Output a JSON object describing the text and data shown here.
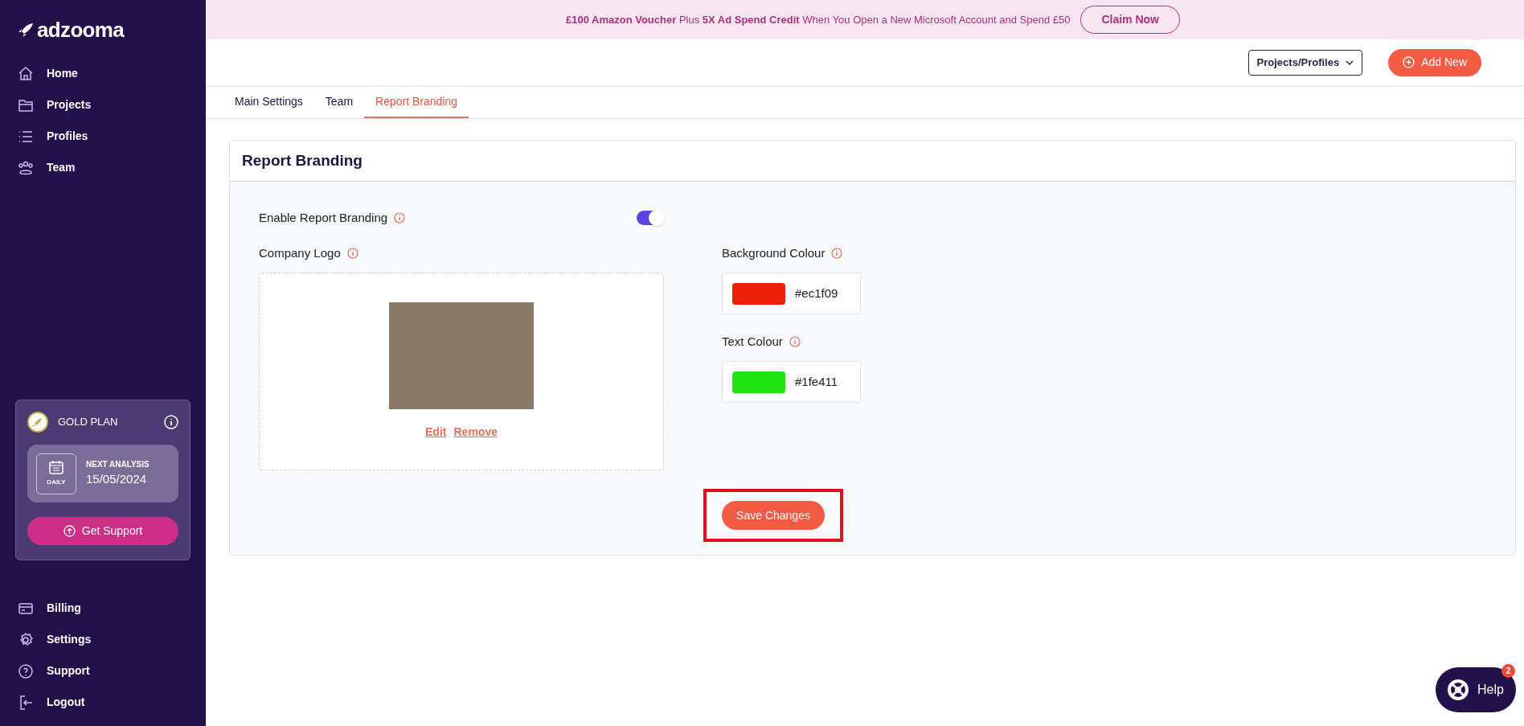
{
  "sidebar": {
    "logo": "adzooma",
    "nav": [
      {
        "label": "Home"
      },
      {
        "label": "Projects"
      },
      {
        "label": "Profiles"
      },
      {
        "label": "Team"
      }
    ],
    "plan": {
      "name": "GOLD PLAN",
      "frequency": "DAILY",
      "next_label": "NEXT ANALYSIS",
      "next_date": "15/05/2024",
      "button": "Get Support"
    },
    "bottom_nav": [
      {
        "label": "Billing"
      },
      {
        "label": "Settings"
      },
      {
        "label": "Support"
      },
      {
        "label": "Logout"
      }
    ]
  },
  "banner": {
    "text": "**£100 Amazon Voucher** Plus **5X Ad Spend Credit** When You Open a New Microsoft Account and Spend £50",
    "button": "Claim Now"
  },
  "header": {
    "dropdown": "Projects/Profiles",
    "add_button": "Add New"
  },
  "tabs": [
    {
      "label": "Main Settings",
      "selected": false
    },
    {
      "label": "Team",
      "selected": false
    },
    {
      "label": "Report Branding",
      "selected": true
    }
  ],
  "card": {
    "title": "Report Branding",
    "enable_label": "Enable Report Branding",
    "enable_on": true,
    "logo_label": "Company Logo",
    "edit_link": "Edit",
    "remove_link": "Remove",
    "colours": [
      {
        "label": "Background Colour",
        "value": "#ec1f09",
        "color": "#ec1f09"
      },
      {
        "label": "Text Colour",
        "value": "#1fe411",
        "color": "#1fe411"
      }
    ],
    "save_button": "Save Changes"
  },
  "help": {
    "label": "Help",
    "badge": "2"
  }
}
